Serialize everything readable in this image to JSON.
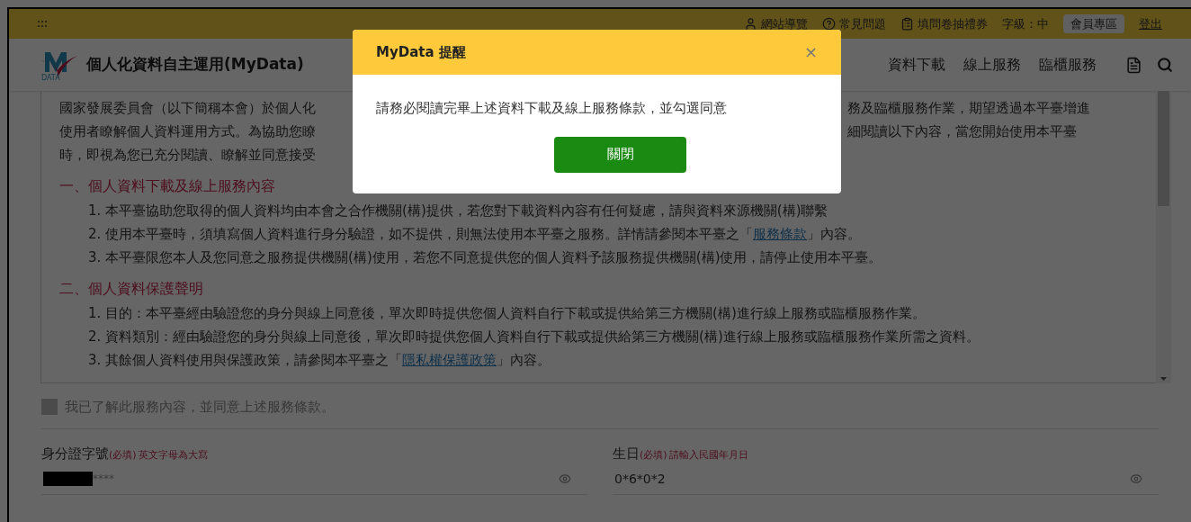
{
  "top_bar": {
    "links": [
      {
        "kind": "user",
        "label": "網站導覽"
      },
      {
        "kind": "help",
        "label": "常見問題"
      },
      {
        "kind": "clipboard",
        "label": "填問卷抽禮券"
      }
    ],
    "font_size": "字級：中",
    "member_button": "會員專區",
    "logout": "登出"
  },
  "header": {
    "logo_text": "DATA",
    "site_title": "個人化資料自主運用(MyData)",
    "nav": [
      "資料下載",
      "線上服務",
      "臨櫃服務"
    ]
  },
  "terms": {
    "intro_lines": [
      {
        "left": "國家發展委員會（以下簡稱本會）於個人化",
        "right": "務及臨櫃服務作業，期望透過本平臺增進"
      },
      {
        "left": "使用者瞭解個人資料運用方式。為協助您瞭",
        "right": "細閱讀以下內容，當您開始使用本平臺"
      },
      {
        "left": "時，即視為您已充分閱讀、瞭解並同意接受"
      }
    ],
    "sections": [
      {
        "heading": "一、個人資料下載及線上服務內容",
        "items": [
          {
            "text": "1. 本平臺協助您取得的個人資料均由本會之合作機關(構)提供，若您對下載資料內容有任何疑慮，請與資料來源機關(構)聯繫"
          },
          {
            "text": "2. 使用本平臺時，須填寫個人資料進行身分驗證，如不提供，則無法使用本平臺之服務。詳情請參閱本平臺之「",
            "link": "服務條款",
            "after": "」內容。"
          },
          {
            "text": "3. 本平臺限您本人及您同意之服務提供機關(構)使用，若您不同意提供您的個人資料予該服務提供機關(構)使用，請停止使用本平臺。"
          }
        ]
      },
      {
        "heading": "二、個人資料保護聲明",
        "items": [
          {
            "text": "1. 目的：本平臺經由驗證您的身分與線上同意後，單次即時提供您個人資料自行下載或提供給第三方機關(構)進行線上服務或臨櫃服務作業。"
          },
          {
            "text": "2. 資料類別：經由驗證您的身分與線上同意後，單次即時提供您個人資料自行下載或提供給第三方機關(構)進行線上服務或臨櫃服務作業所需之資料。"
          },
          {
            "text": "3. 其餘個人資料使用與保護政策，請參閱本平臺之「",
            "link": "隱私權保護政策",
            "after": "」內容。"
          }
        ]
      }
    ]
  },
  "agree": {
    "label": "我已了解此服務內容，並同意上述服務條款。",
    "checked": false,
    "disabled": true
  },
  "fields": [
    {
      "label": "身分證字號",
      "required": "(必填)",
      "hint": "英文字母為大寫",
      "redacted": true,
      "value": "****"
    },
    {
      "label": "生日",
      "required": "(必填)",
      "hint": "請輸入民國年月日",
      "redacted": false,
      "value": "0*6*0*2"
    }
  ],
  "dialog": {
    "title": "MyData 提醒",
    "close": "×",
    "message": "請務必閱讀完畢上述資料下載及線上服務條款，並勾選同意",
    "button": "關閉"
  }
}
